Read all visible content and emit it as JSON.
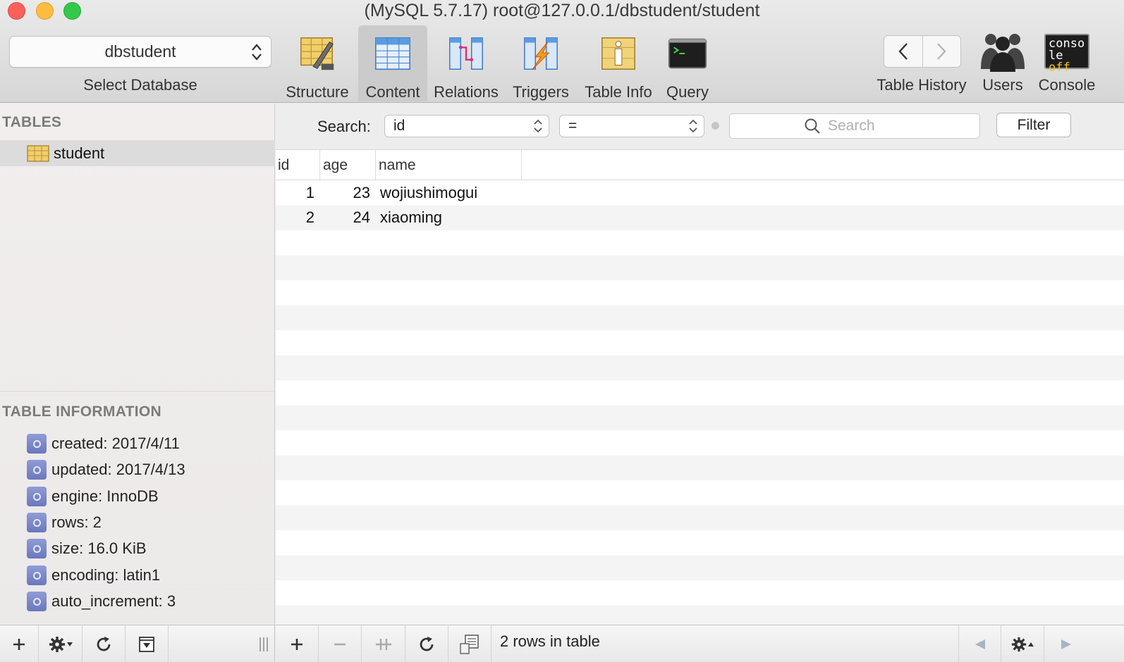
{
  "window": {
    "title": "(MySQL 5.7.17) root@127.0.0.1/dbstudent/student"
  },
  "toolbar": {
    "database_value": "dbstudent",
    "database_caption": "Select Database",
    "buttons": [
      {
        "label": "Structure",
        "icon": "structure-icon"
      },
      {
        "label": "Content",
        "icon": "content-icon",
        "active": true
      },
      {
        "label": "Relations",
        "icon": "relations-icon"
      },
      {
        "label": "Triggers",
        "icon": "triggers-icon"
      },
      {
        "label": "Table Info",
        "icon": "table-info-icon"
      },
      {
        "label": "Query",
        "icon": "query-icon"
      }
    ],
    "table_history_label": "Table History",
    "users_label": "Users",
    "console_label": "Console",
    "console_icon_text_top": "conso",
    "console_icon_text_bottom_a": "le ",
    "console_icon_text_bottom_b": "off"
  },
  "sidebar": {
    "tables_heading": "TABLES",
    "tables": [
      {
        "name": "student",
        "selected": true
      }
    ],
    "info_heading": "TABLE INFORMATION",
    "info": [
      "created: 2017/4/11",
      "updated: 2017/4/13",
      "engine: InnoDB",
      "rows: 2",
      "size: 16.0 KiB",
      "encoding: latin1",
      "auto_increment: 3"
    ]
  },
  "filter": {
    "label": "Search:",
    "field": "id",
    "operator": "=",
    "search_placeholder": "Search",
    "button_label": "Filter"
  },
  "grid": {
    "columns": [
      "id",
      "age",
      "name"
    ],
    "rows": [
      {
        "id": "1",
        "age": "23",
        "name": "wojiushimogui"
      },
      {
        "id": "2",
        "age": "24",
        "name": "xiaoming"
      }
    ]
  },
  "status": {
    "row_count_text": "2 rows in table"
  },
  "colors": {
    "selection": "#dcdcdc",
    "info_badge": "#7885c6",
    "close": "#fc605b",
    "minimize": "#fdbc40",
    "zoom": "#34c84a"
  }
}
